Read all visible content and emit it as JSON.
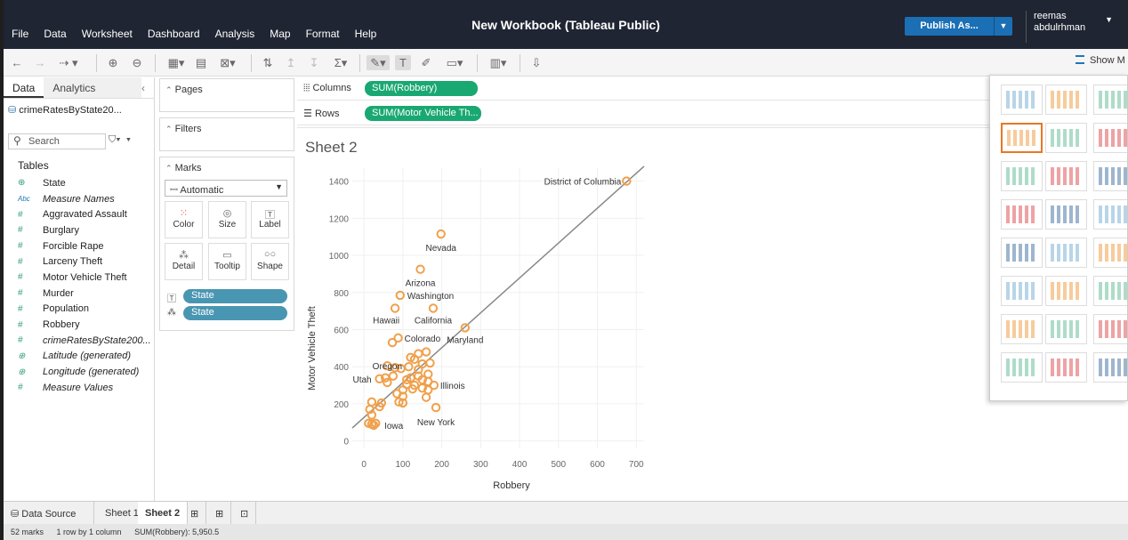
{
  "window": {
    "title": "New Workbook (Tableau Public)"
  },
  "menu": [
    "File",
    "Data",
    "Worksheet",
    "Dashboard",
    "Analysis",
    "Map",
    "Format",
    "Help"
  ],
  "publish": {
    "label": "Publish As..."
  },
  "user": {
    "line1": "reemas",
    "line2": "abdulrhman"
  },
  "toolbar": {
    "show_me_label": "Show M"
  },
  "data_pane": {
    "tab_data": "Data",
    "tab_analytics": "Analytics",
    "datasource": "crimeRatesByState20...",
    "search_placeholder": "Search",
    "tables_heading": "Tables",
    "fields": [
      {
        "type": "geo",
        "name": "State",
        "italic": false
      },
      {
        "type": "abc",
        "name": "Measure Names",
        "italic": true
      },
      {
        "type": "num",
        "name": "Aggravated Assault",
        "italic": false
      },
      {
        "type": "num",
        "name": "Burglary",
        "italic": false
      },
      {
        "type": "num",
        "name": "Forcible Rape",
        "italic": false
      },
      {
        "type": "num",
        "name": "Larceny Theft",
        "italic": false
      },
      {
        "type": "num",
        "name": "Motor Vehicle Theft",
        "italic": false
      },
      {
        "type": "num",
        "name": "Murder",
        "italic": false
      },
      {
        "type": "num",
        "name": "Population",
        "italic": false
      },
      {
        "type": "num",
        "name": "Robbery",
        "italic": false
      },
      {
        "type": "num",
        "name": "crimeRatesByState200...",
        "italic": true
      },
      {
        "type": "geo",
        "name": "Latitude (generated)",
        "italic": true
      },
      {
        "type": "geo",
        "name": "Longitude (generated)",
        "italic": true
      },
      {
        "type": "num",
        "name": "Measure Values",
        "italic": true
      }
    ]
  },
  "pages": {
    "label": "Pages"
  },
  "filters": {
    "label": "Filters"
  },
  "marks": {
    "label": "Marks",
    "type": "Automatic",
    "buttons": {
      "color": "Color",
      "size": "Size",
      "label": "Label",
      "detail": "Detail",
      "tooltip": "Tooltip",
      "shape": "Shape"
    },
    "pill_label": "State",
    "pill_detail": "State"
  },
  "shelves": {
    "columns_label": "Columns",
    "columns_pill": "SUM(Robbery)",
    "rows_label": "Rows",
    "rows_pill": "SUM(Motor Vehicle Th..."
  },
  "sheet": {
    "title": "Sheet 2"
  },
  "chart_data": {
    "type": "scatter",
    "xlabel": "Robbery",
    "ylabel": "Motor Vehicle Theft",
    "xlim": [
      -30,
      720
    ],
    "ylim": [
      -40,
      1470
    ],
    "x_ticks": [
      0,
      100,
      200,
      300,
      400,
      500,
      600,
      700
    ],
    "y_ticks": [
      0,
      200,
      400,
      600,
      800,
      1000,
      1200,
      1400
    ],
    "grid": true,
    "marker_color": "#f0a04b",
    "trend_line": {
      "color": "#888888",
      "from": [
        -30,
        70
      ],
      "to": [
        720,
        1480
      ]
    },
    "points": [
      {
        "x": 675,
        "y": 1400,
        "label": "District of Columbia"
      },
      {
        "x": 198,
        "y": 1115,
        "label": "Nevada"
      },
      {
        "x": 145,
        "y": 925,
        "label": "Arizona"
      },
      {
        "x": 93,
        "y": 785,
        "label": "Washington"
      },
      {
        "x": 80,
        "y": 715,
        "label": "Hawaii"
      },
      {
        "x": 178,
        "y": 715,
        "label": "California"
      },
      {
        "x": 260,
        "y": 610,
        "label": "Maryland"
      },
      {
        "x": 88,
        "y": 555,
        "label": "Colorado"
      },
      {
        "x": 73,
        "y": 530,
        "label": ""
      },
      {
        "x": 40,
        "y": 335,
        "label": "Utah"
      },
      {
        "x": 180,
        "y": 300,
        "label": "Illinois"
      },
      {
        "x": 185,
        "y": 180,
        "label": "New York"
      },
      {
        "x": 25,
        "y": 85,
        "label": "Iowa"
      },
      {
        "x": 60,
        "y": 405,
        "label": "Oregon"
      },
      {
        "x": 140,
        "y": 470,
        "label": ""
      },
      {
        "x": 160,
        "y": 480,
        "label": ""
      },
      {
        "x": 130,
        "y": 440,
        "label": ""
      },
      {
        "x": 150,
        "y": 415,
        "label": ""
      },
      {
        "x": 170,
        "y": 420,
        "label": ""
      },
      {
        "x": 80,
        "y": 395,
        "label": ""
      },
      {
        "x": 95,
        "y": 390,
        "label": ""
      },
      {
        "x": 140,
        "y": 385,
        "label": ""
      },
      {
        "x": 165,
        "y": 360,
        "label": ""
      },
      {
        "x": 120,
        "y": 340,
        "label": ""
      },
      {
        "x": 150,
        "y": 330,
        "label": ""
      },
      {
        "x": 165,
        "y": 320,
        "label": ""
      },
      {
        "x": 130,
        "y": 300,
        "label": ""
      },
      {
        "x": 110,
        "y": 305,
        "label": ""
      },
      {
        "x": 60,
        "y": 315,
        "label": ""
      },
      {
        "x": 150,
        "y": 285,
        "label": ""
      },
      {
        "x": 125,
        "y": 280,
        "label": ""
      },
      {
        "x": 100,
        "y": 275,
        "label": ""
      },
      {
        "x": 165,
        "y": 275,
        "label": ""
      },
      {
        "x": 85,
        "y": 255,
        "label": ""
      },
      {
        "x": 100,
        "y": 240,
        "label": ""
      },
      {
        "x": 160,
        "y": 235,
        "label": ""
      },
      {
        "x": 90,
        "y": 210,
        "label": ""
      },
      {
        "x": 100,
        "y": 205,
        "label": ""
      },
      {
        "x": 45,
        "y": 205,
        "label": ""
      },
      {
        "x": 20,
        "y": 210,
        "label": ""
      },
      {
        "x": 40,
        "y": 185,
        "label": ""
      },
      {
        "x": 15,
        "y": 170,
        "label": ""
      },
      {
        "x": 20,
        "y": 140,
        "label": ""
      },
      {
        "x": 12,
        "y": 95,
        "label": ""
      },
      {
        "x": 20,
        "y": 90,
        "label": ""
      },
      {
        "x": 30,
        "y": 95,
        "label": ""
      },
      {
        "x": 110,
        "y": 330,
        "label": ""
      },
      {
        "x": 75,
        "y": 350,
        "label": ""
      },
      {
        "x": 140,
        "y": 350,
        "label": ""
      },
      {
        "x": 120,
        "y": 450,
        "label": ""
      },
      {
        "x": 115,
        "y": 400,
        "label": ""
      },
      {
        "x": 55,
        "y": 340,
        "label": ""
      }
    ]
  },
  "bottom": {
    "data_source": "Data Source",
    "sheet1": "Sheet 1",
    "sheet2": "Sheet 2"
  },
  "status": {
    "marks": "52 marks",
    "dims": "1 row by 1 column",
    "sum": "SUM(Robbery): 5,950.5"
  }
}
